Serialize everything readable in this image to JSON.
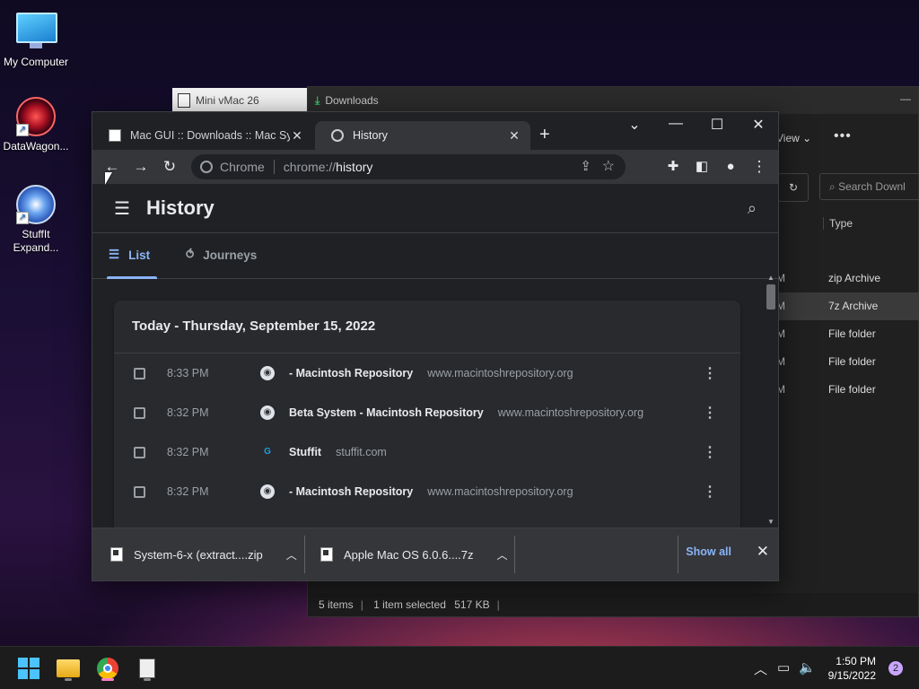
{
  "desktop": {
    "icons": [
      {
        "label": "My Computer"
      },
      {
        "label": "DataWagon..."
      },
      {
        "label": "StuffIt Expand..."
      }
    ]
  },
  "vmac_window": {
    "title": "Mini vMac 26"
  },
  "explorer": {
    "title": "Downloads",
    "view_label": "View",
    "search_placeholder": "Search Downl",
    "type_header": "Type",
    "rows": [
      {
        "m": "M",
        "type": "zip Archive"
      },
      {
        "m": "M",
        "type": "7z Archive"
      },
      {
        "m": "M",
        "type": "File folder"
      },
      {
        "m": "M",
        "type": "File folder"
      },
      {
        "m": "M",
        "type": "File folder"
      }
    ],
    "status": {
      "items": "5 items",
      "selected": "1 item selected",
      "size": "517 KB"
    }
  },
  "chrome": {
    "tabs": [
      {
        "title": "Mac GUI :: Downloads :: Mac Syst"
      },
      {
        "title": "History"
      }
    ],
    "omnibox": {
      "chip": "Chrome",
      "url_prefix": "chrome://",
      "url_path": "history"
    },
    "page": {
      "title": "History",
      "tabs": {
        "list": "List",
        "journeys": "Journeys"
      },
      "date_header": "Today - Thursday, September 15, 2022",
      "entries": [
        {
          "time": "8:33 PM",
          "title": "- Macintosh Repository",
          "domain": "www.macintoshrepository.org"
        },
        {
          "time": "8:32 PM",
          "title": "Beta System - Macintosh Repository",
          "domain": "www.macintoshrepository.org"
        },
        {
          "time": "8:32 PM",
          "title": "Stuffit",
          "domain": "stuffit.com"
        },
        {
          "time": "8:32 PM",
          "title": "- Macintosh Repository",
          "domain": "www.macintoshrepository.org"
        }
      ]
    },
    "downloads": [
      {
        "name": "System-6-x (extract....zip"
      },
      {
        "name": "Apple Mac OS 6.0.6....7z"
      }
    ],
    "show_all": "Show all"
  },
  "taskbar": {
    "time": "1:50 PM",
    "date": "9/15/2022",
    "notifications": "2"
  }
}
